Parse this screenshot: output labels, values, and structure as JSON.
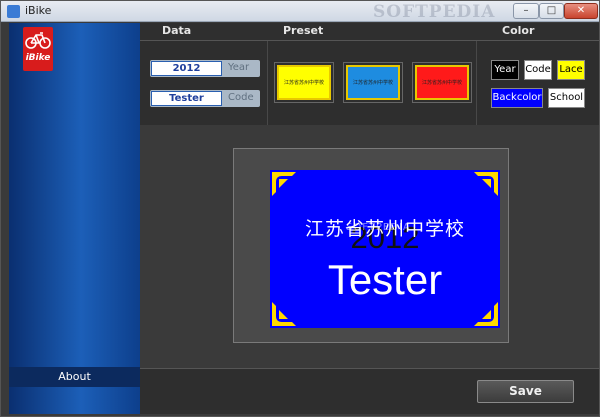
{
  "window": {
    "title": "iBike",
    "watermark": "SOFTPEDIA",
    "min_glyph": "–",
    "max_glyph": "□",
    "close_glyph": "✕"
  },
  "sidebar": {
    "logo_text": "iBike",
    "about_label": "About"
  },
  "headers": {
    "data": "Data",
    "preset": "Preset",
    "color": "Color"
  },
  "data_section": {
    "year_value": "2012",
    "year_label": "Year",
    "code_value": "Tester",
    "code_label": "Code"
  },
  "presets": [
    {
      "text": "江苏省苏州中学校",
      "bg": "#ffff00",
      "border": "#e8c800"
    },
    {
      "text": "江苏省苏州中学校",
      "bg": "#1e8ce0",
      "border": "#e8c800"
    },
    {
      "text": "江苏省苏州中学校",
      "bg": "#ff1a1a",
      "border": "#e8c800"
    }
  ],
  "color_section": {
    "year": {
      "label": "Year",
      "bg": "#000000",
      "fg": "#ffffff"
    },
    "code": {
      "label": "Code",
      "bg": "#ffffff",
      "fg": "#000000"
    },
    "lace": {
      "label": "Lace",
      "bg": "#ffff00",
      "fg": "#000000"
    },
    "backcolor": {
      "label": "Backcolor",
      "bg": "#0000ff",
      "fg": "#ffffff"
    },
    "school": {
      "label": "School",
      "bg": "#ffffff",
      "fg": "#000000"
    }
  },
  "preview": {
    "school_text": "江苏省苏州中学校",
    "year": "2012",
    "code": "Tester",
    "watermark": "SOFTPEDIA",
    "bg": "#0000ff"
  },
  "footer": {
    "save_label": "Save"
  }
}
